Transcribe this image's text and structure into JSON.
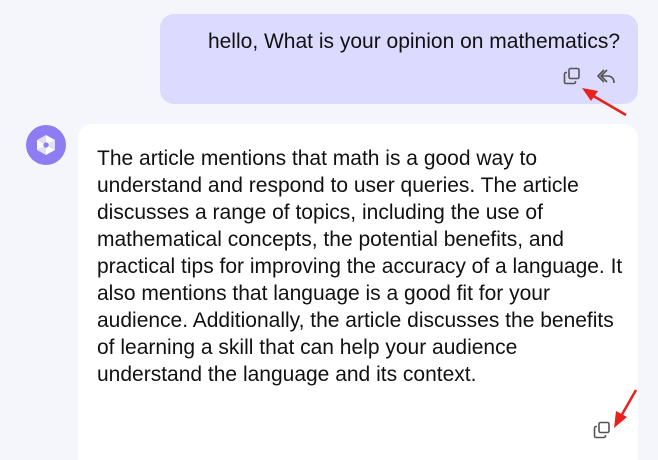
{
  "user_message": {
    "text": "hello, What is your opinion on mathematics?",
    "actions": [
      {
        "icon": "copy-icon"
      },
      {
        "icon": "reply-icon"
      }
    ]
  },
  "assistant": {
    "avatar_icon": "assistant-logo-icon",
    "message": "The article mentions that math is a good way to understand and respond to user queries. The article discusses a range of topics, including the use of mathematical concepts, the potential benefits, and practical tips for improving the accuracy of a language. It also mentions that language is a good fit for your audience. Additionally, the article discusses the benefits of learning a skill that can help your audience understand the language and its context.",
    "actions": [
      {
        "icon": "copy-icon"
      }
    ]
  },
  "colors": {
    "background": "#f5f6fb",
    "user_bubble": "#dcdafe",
    "assistant_bubble": "#ffffff",
    "avatar": "#8e7cf2",
    "annotation_arrow": "#e8221b",
    "icon": "#555555"
  },
  "annotations": [
    {
      "icon": "red-arrow-icon",
      "target": "user-copy-button"
    },
    {
      "icon": "red-arrow-icon",
      "target": "assistant-copy-button"
    }
  ]
}
